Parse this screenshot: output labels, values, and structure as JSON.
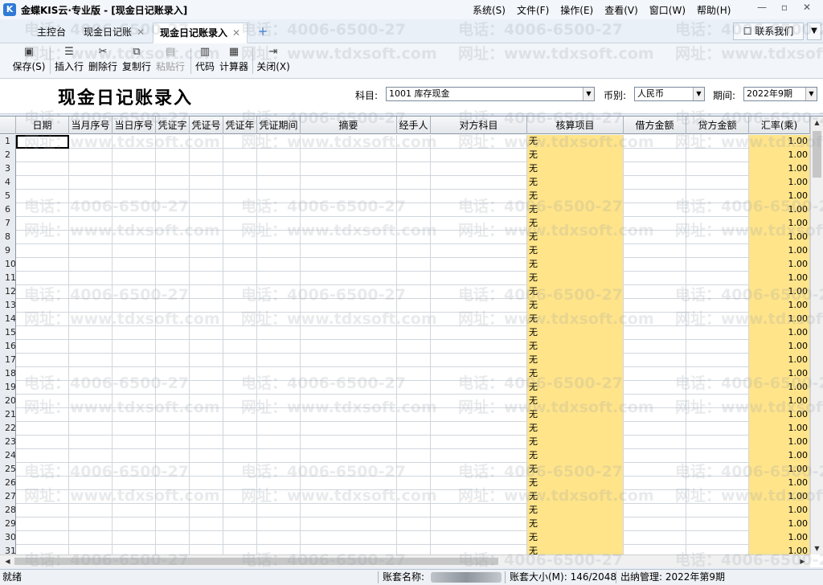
{
  "app": {
    "title": "金蝶KIS云·专业版 - [现金日记账录入]",
    "icon": "kis-app-icon",
    "menu": [
      "系统(S)",
      "文件(F)",
      "操作(E)",
      "查看(V)",
      "窗口(W)",
      "帮助(H)"
    ],
    "window_controls": [
      "—",
      "▫",
      "✕"
    ]
  },
  "tabs": [
    {
      "label": "主控台",
      "closable": false,
      "active": false
    },
    {
      "label": "现金日记账",
      "closable": true,
      "active": false
    },
    {
      "label": "现金日记账录入",
      "closable": true,
      "active": true
    }
  ],
  "tab_add_icon": "+",
  "contact": {
    "label": "联系我们"
  },
  "toolbar": {
    "save": "保存(S)",
    "insert_row": "插入行",
    "delete_row": "删除行",
    "copy_row": "复制行",
    "paste_row": "粘贴行",
    "code": "代码",
    "calculator": "计算器",
    "close": "关闭(X)"
  },
  "form": {
    "title": "现金日记账录入",
    "subject_label": "科目:",
    "subject_value": "1001 库存现金",
    "currency_label": "币别:",
    "currency_value": "人民币",
    "period_label": "期间:",
    "period_value": "2022年9期"
  },
  "grid": {
    "columns": [
      "日期",
      "当月序号",
      "当日序号",
      "凭证字",
      "凭证号",
      "凭证年",
      "凭证期间",
      "摘要",
      "经手人",
      "对方科目",
      "核算项目",
      "借方金额",
      "贷方金额",
      "汇率(乘)"
    ],
    "row_numbers": [
      "1",
      "2",
      "3",
      "4",
      "5",
      "6",
      "7",
      "8",
      "9",
      "10",
      "11",
      "12",
      "13",
      "14",
      "15",
      "16",
      "17",
      "18",
      "19",
      "20",
      "21",
      "22",
      "23",
      "24",
      "25",
      "26",
      "27",
      "28",
      "29",
      "30",
      "31"
    ],
    "accounting_item_value": "无",
    "exchange_rate_value": "1.00"
  },
  "watermark": {
    "phone": "电话：4006-6500-27",
    "site": "网址：www.tdxsoft.com"
  },
  "status": {
    "ready": "就绪",
    "account_set_label": "账套名称:",
    "account_size": "账套大小(M): 146/2048",
    "cashier": "出纳管理: 2022年第9期"
  }
}
